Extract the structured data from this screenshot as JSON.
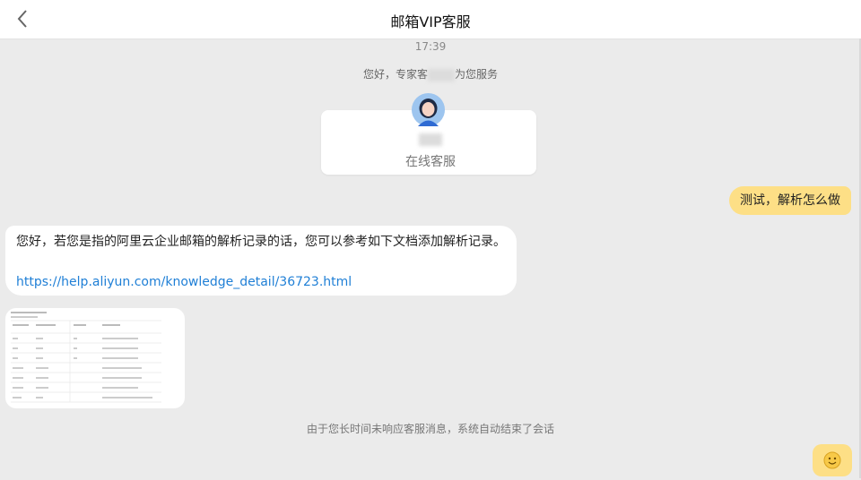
{
  "header": {
    "title": "邮箱VIP客服",
    "back_icon": "chevron-left-icon"
  },
  "chat": {
    "timestamp": "17:39",
    "greeting_prefix": "您好，专家客",
    "greeting_suffix": "为您服务",
    "agent": {
      "role": "在线客服",
      "avatar_icon": "agent-avatar-icon"
    },
    "messages": [
      {
        "from": "user",
        "text": "测试，解析怎么做"
      },
      {
        "from": "agent",
        "text": "您好，若您是指的阿里云企业邮箱的解析记录的话，您可以参考如下文档添加解析记录。",
        "link": "https://help.aliyun.com/knowledge_detail/36723.html"
      }
    ],
    "end_notice": "由于您长时间未响应客服消息，系统自动结束了会话"
  },
  "controls": {
    "emoji_icon": "smiley-icon"
  },
  "colors": {
    "background": "#ebebeb",
    "user_bubble": "#fddf86",
    "link": "#1f7fd6"
  }
}
